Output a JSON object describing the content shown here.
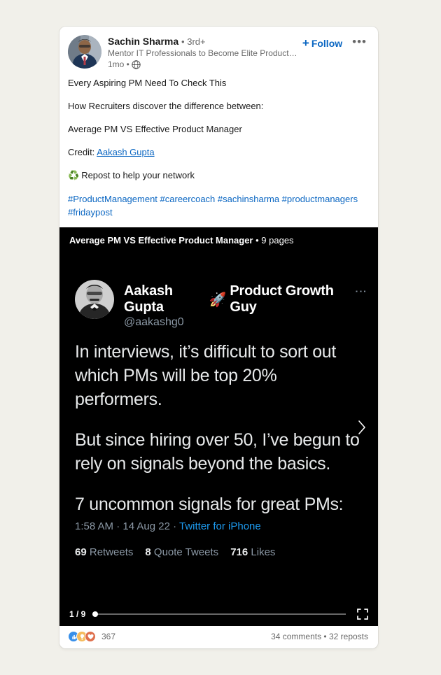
{
  "post": {
    "author": {
      "name": "Sachin Sharma",
      "degree": "• 3rd+",
      "headline": "Mentor IT Professionals to Become Elite Product Manager...",
      "time": "1mo •",
      "visibility_icon": "globe-icon",
      "avatar_alt": "author-avatar"
    },
    "actions": {
      "follow_plus": "+",
      "follow_label": "Follow",
      "overflow_label": "•••"
    },
    "body": {
      "line1": "Every Aspiring PM Need To Check This",
      "line2": "How Recruiters discover the difference between:",
      "line3": "Average PM VS Effective Product Manager",
      "credit_prefix": "Credit: ",
      "credit_link": "Aakash Gupta",
      "repost_emoji": "♻️",
      "repost_text": "Repost to help your network",
      "hashtags": "#ProductManagement #careercoach #sachinsharma #productmanagers #fridaypost"
    }
  },
  "document": {
    "title": "Average PM VS Effective Product Manager",
    "pages_label": "• 9 pages",
    "page_counter": "1 / 9",
    "next_arrow_icon": "chevron-right-icon",
    "fullscreen_icon": "fullscreen-icon",
    "slide": {
      "tweet_author_name": "Aakash Gupta",
      "tweet_author_emoji": "🚀",
      "tweet_author_suffix": "Product Growth Guy",
      "tweet_handle": "@aakashg0",
      "kebab_label": "⋮",
      "paragraph1": "In interviews, it’s difficult to sort out which PMs will be top 20% performers.",
      "paragraph2": "But since hiring over 50, I’ve begun to rely on signals beyond the basics.",
      "paragraph3": "7 uncommon signals for great PMs:",
      "timestamp": "1:58 AM · 14 Aug 22 · ",
      "source": "Twitter for iPhone",
      "retweets_count": "69",
      "retweets_label": "Retweets",
      "quotes_count": "8",
      "quotes_label": "Quote Tweets",
      "likes_count": "716",
      "likes_label": "Likes"
    }
  },
  "social": {
    "reaction_icons": [
      "like-icon",
      "insightful-icon",
      "love-icon"
    ],
    "reaction_count": "367",
    "engagement": "34 comments • 32 reposts"
  },
  "colors": {
    "linkedin_blue": "#0a66c2",
    "twitter_blue": "#1d9bf0",
    "page_bg": "#f1f0ea",
    "viewer_bg": "#000000"
  }
}
